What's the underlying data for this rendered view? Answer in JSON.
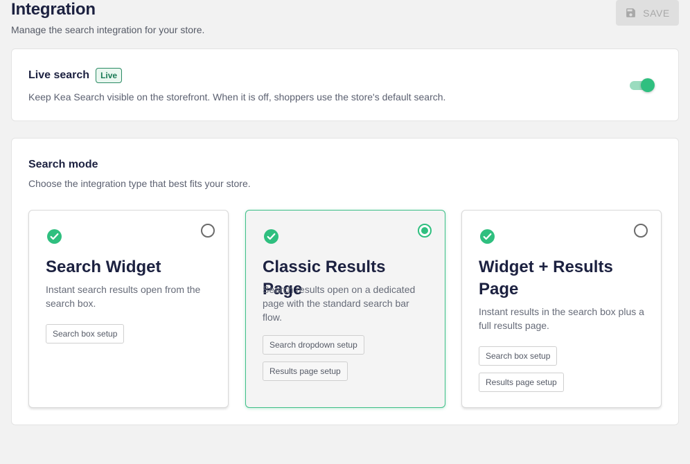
{
  "header": {
    "title": "Integration",
    "subtitle": "Manage the search integration for your store.",
    "save_label": "SAVE",
    "save_icon": "save-icon"
  },
  "live_search": {
    "title": "Live search",
    "badge": "Live",
    "description": "Keep Kea Search visible on the storefront. When it is off, shoppers use the store's default search.",
    "toggle_on": true
  },
  "search_mode": {
    "title": "Search mode",
    "description": "Choose the integration type that best fits your store.",
    "selected": "Classic Results Page",
    "options": [
      {
        "title": "Search Widget",
        "description": "Instant search results open from the search box.",
        "buttons": [
          "Search box setup"
        ]
      },
      {
        "title": "Classic Results Page",
        "description": "Search results open on a dedicated page with the standard search bar flow.",
        "buttons": [
          "Search dropdown setup",
          "Results page setup"
        ]
      },
      {
        "title": "Widget + Results Page",
        "description": "Instant results in the search box plus a full results page.",
        "buttons": [
          "Search box setup",
          "Results page setup"
        ]
      }
    ]
  },
  "colors": {
    "accent": "#2fbf7f",
    "title": "#1c2140",
    "background": "#f2f2f2"
  }
}
